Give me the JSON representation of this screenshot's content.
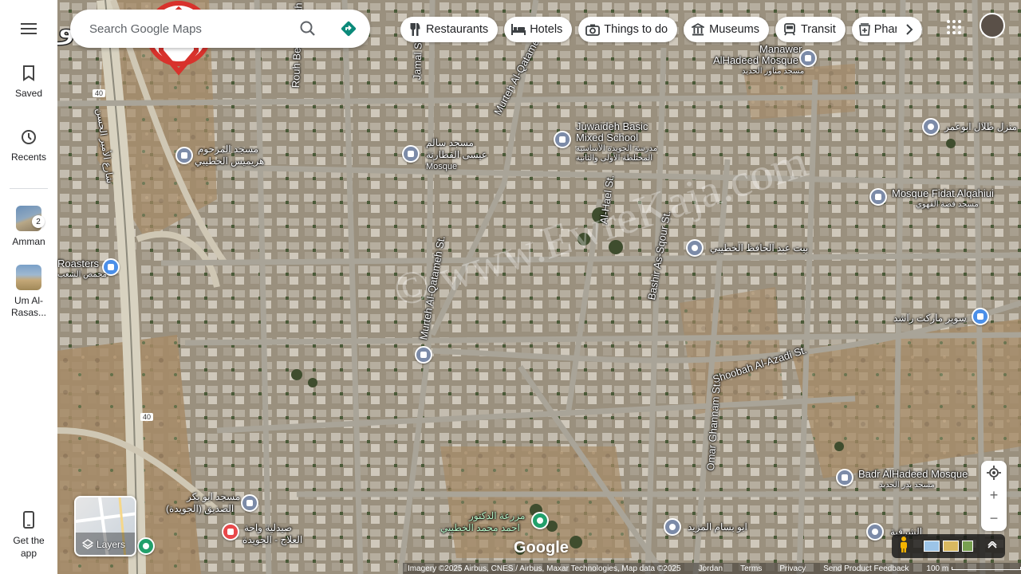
{
  "sidebar": {
    "saved": "Saved",
    "recents": "Recents",
    "places": [
      {
        "label": "Amman",
        "badge": "2"
      },
      {
        "label": "Um Al-\nRasas..."
      }
    ],
    "get_app": "Get the\napp"
  },
  "search": {
    "placeholder": "Search Google Maps"
  },
  "chips": [
    {
      "label": "Restaurants",
      "icon": "fork-knife-icon"
    },
    {
      "label": "Hotels",
      "icon": "bed-icon"
    },
    {
      "label": "Things to do",
      "icon": "camera-icon"
    },
    {
      "label": "Museums",
      "icon": "museum-icon"
    },
    {
      "label": "Transit",
      "icon": "train-icon"
    },
    {
      "label": "Pharmacies",
      "icon": "pharmacy-icon"
    }
  ],
  "map_labels": {
    "manawer": "Manawer",
    "alhadeed_mosque": "AlHadeed Mosque",
    "alhadeed_ar": "مسجد مناور الحديد",
    "juwaideh_1": "Juwaideh Basic",
    "juwaideh_2": "Mixed School",
    "juwaideh_ar1": "مدرسة الجويدة الأساسية",
    "juwaideh_ar2": "المختلطة الأولى والثانية",
    "mosque_fidat": "Mosque Fidat Alqahiui",
    "mosque_fidat_ar": "مسجد فضة القهوي",
    "masjid_salem_ar1": "مسجد سالم",
    "masjid_salem_ar2": "عيسى القطارنة",
    "masjid_salem_en": "Mosque",
    "masjid_khatib_ar1": "مسجد المرحوم",
    "masjid_khatib_ar2": "هريميس الخطيبي",
    "house_abu_omar": "منزل طلال ابوعمر",
    "house_abdulhafez": "بيت عبد الحافظ الخطيبي",
    "super_market": "سوبر ماركت راشد",
    "roasters": "Roasters",
    "roasters_ar": "محمص الشعب",
    "badr": "Badr AlHadeed Mosque",
    "badr_ar": "مسجد بدر الحديد",
    "masjid_abubakr_ar1": "مسجد ابو بكر",
    "masjid_abubakr_ar2": "الصديق (الجويدة)",
    "pharmacy_ar1": "صيدلية واحة",
    "pharmacy_ar2": "العلاج - الجويدة",
    "farm_ar1": "مزرعة الدكتور",
    "farm_ar2": "احمد محمد الخطيبي",
    "abu_bassam": "ابو بسام المزيد",
    "sharqia_ar": "الشرقية",
    "ameer_hassan_ar": "شارع الأمير الحسن",
    "st_rouh": "Rouh Ben Ubadah St.",
    "st_murteh_north": "Murteh Al-Qatameh St.",
    "st_murteh_south": "Murteh Al-Qatameh St.",
    "st_alhael": "Al-Hael St.",
    "st_bashir": "Bashir As-Sqour St.",
    "st_shoobah": "Shoobah Al-Azadi St.",
    "st_omar": "Omar Ghannam St.",
    "st_jamal": "Jamal St.",
    "shield_40": "40",
    "watermark": "© www.EwreKaja.com"
  },
  "layers_label": "Layers",
  "google_logo": "Google",
  "footer": {
    "imagery": "Imagery ©2025 Airbus, CNES / Airbus, Maxar Technologies, Map data ©2025",
    "country": "Jordan",
    "terms": "Terms",
    "privacy": "Privacy",
    "feedback": "Send Product Feedback",
    "scale": "100 m"
  },
  "colors": {
    "accent": "#1a73e8",
    "directions": "#0b8a7a"
  }
}
